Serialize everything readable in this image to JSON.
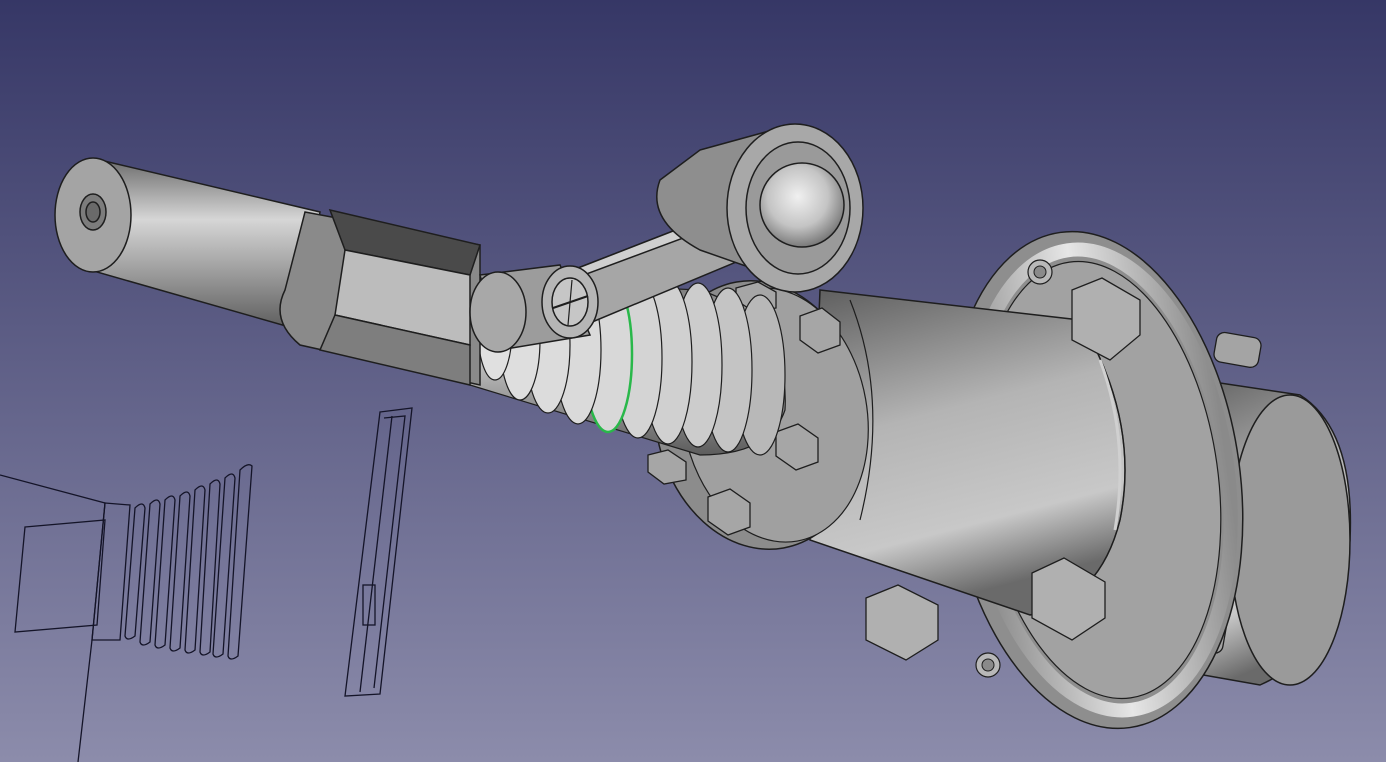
{
  "app": "FreeCAD 3D View",
  "viewport": {
    "background_top": "#363766",
    "background_bottom": "#8c8cab",
    "model_face_color": "#9e9e9e",
    "model_highlight_color": "#e8e8e8",
    "model_shadow_color": "#5a5a5a",
    "edge_color": "#1e1e1e",
    "preselect_edge_color": "#29b84a",
    "wireframe_color": "#141428"
  },
  "scene_objects": [
    "handle-shaft",
    "handle-hex-grip",
    "bellows-boot",
    "lever-arm",
    "lever-pivot-cap",
    "ball-knob",
    "flange-plate",
    "main-cylinder-body",
    "rear-flange",
    "rear-cylinder",
    "wireframe-bellows",
    "wireframe-plate"
  ]
}
